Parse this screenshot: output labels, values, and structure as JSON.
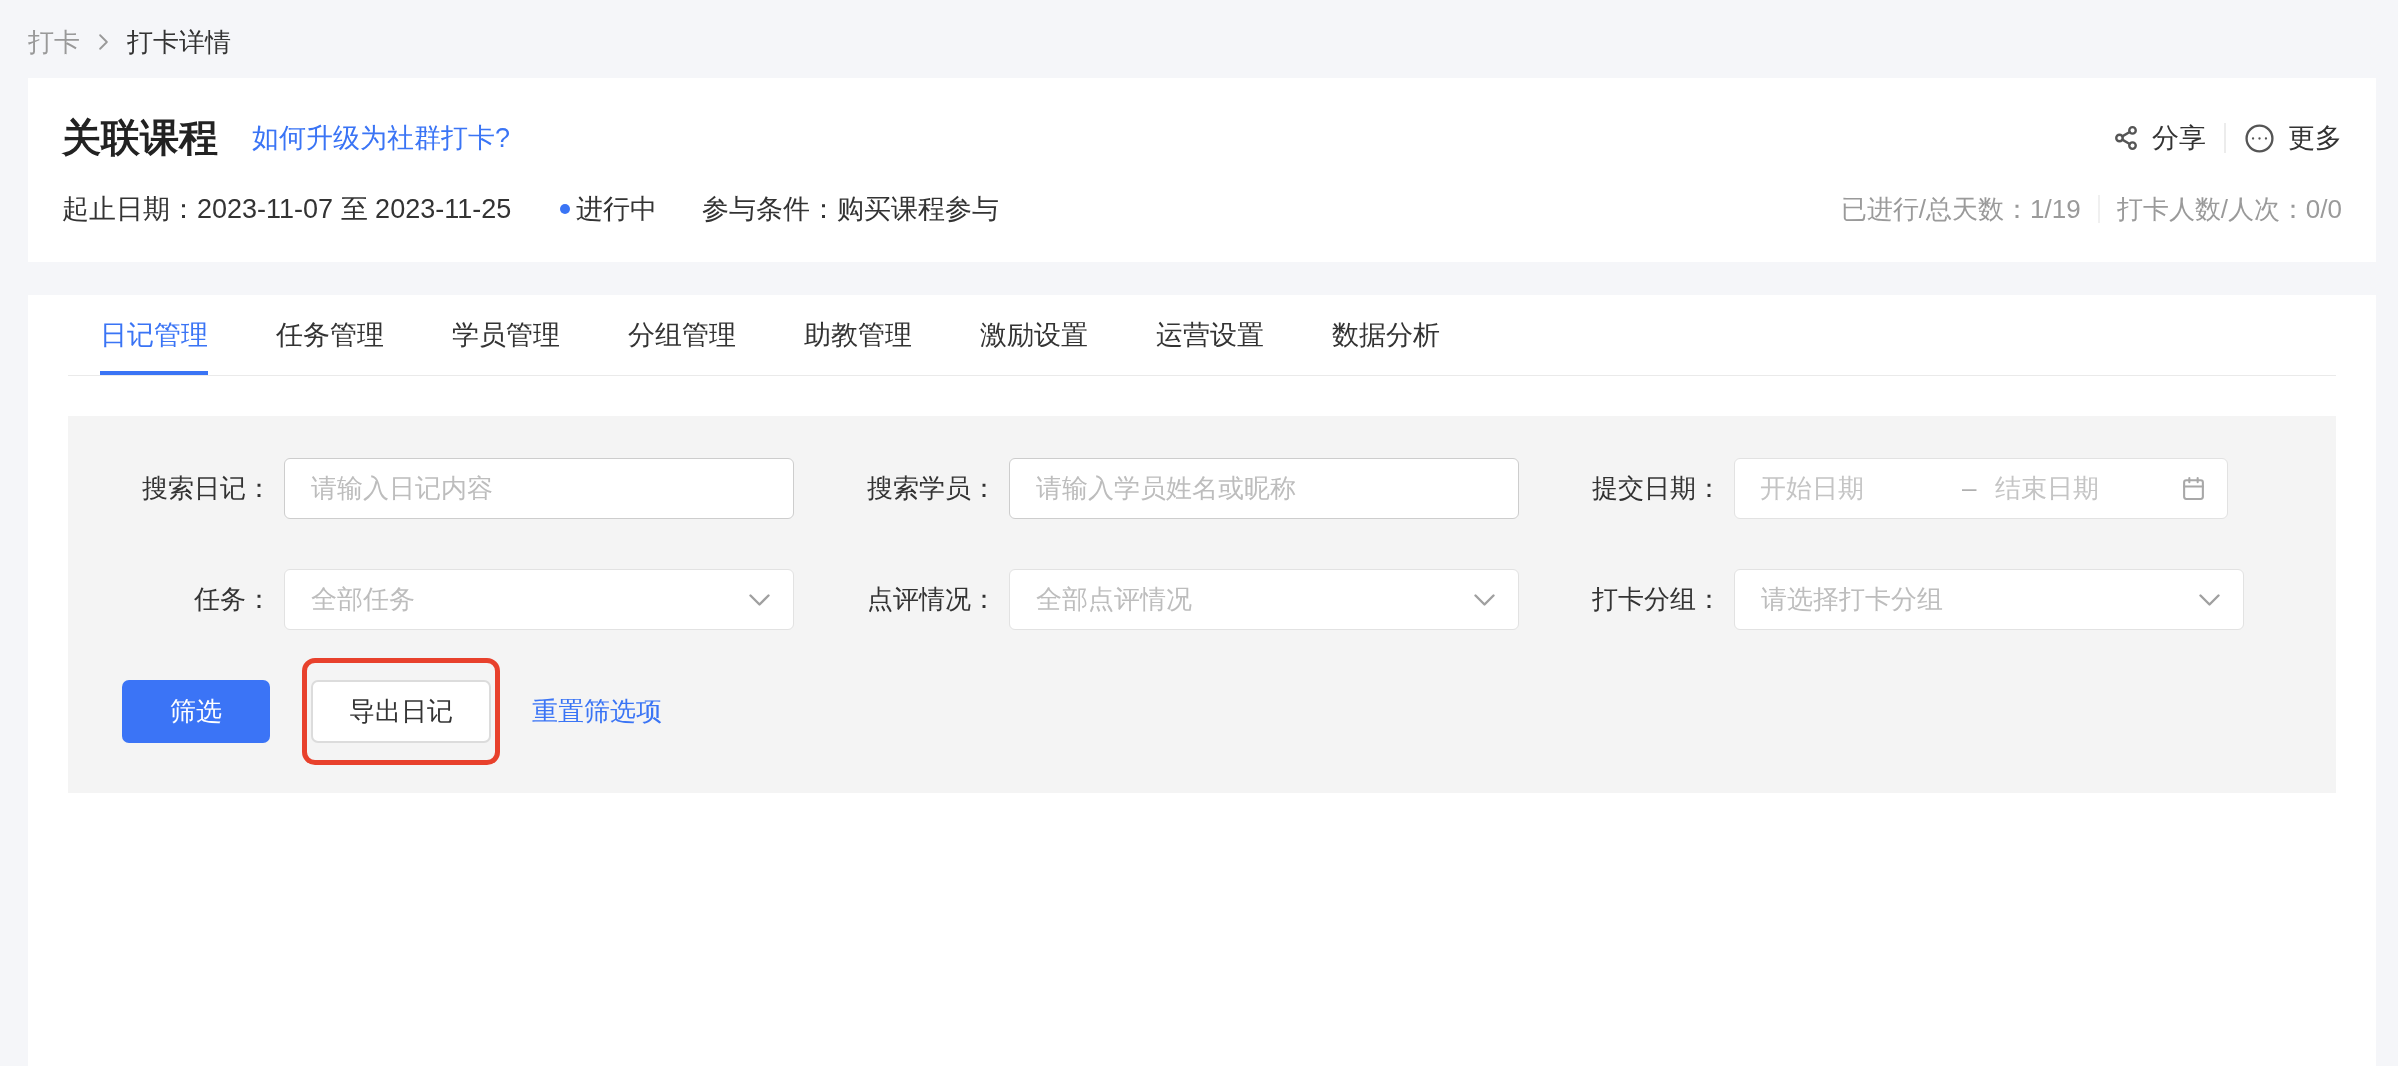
{
  "breadcrumb": [
    {
      "label": "打卡",
      "current": false
    },
    {
      "label": "打卡详情",
      "current": true
    }
  ],
  "header": {
    "title": "关联课程",
    "help_link": "如何升级为社群打卡?",
    "date_range": "起止日期：2023-11-07 至 2023-11-25",
    "status": {
      "label": "进行中",
      "color": "#3a74f5"
    },
    "condition": "参与条件：购买课程参与",
    "actions": [
      {
        "kind": "share",
        "label": "分享"
      },
      {
        "kind": "more",
        "label": "更多"
      }
    ],
    "stats": [
      "已进行/总天数：1/19",
      "打卡人数/人次：0/0"
    ]
  },
  "tabs": [
    {
      "label": "日记管理",
      "selected": true
    },
    {
      "label": "任务管理",
      "selected": false
    },
    {
      "label": "学员管理",
      "selected": false
    },
    {
      "label": "分组管理",
      "selected": false
    },
    {
      "label": "助教管理",
      "selected": false
    },
    {
      "label": "激励设置",
      "selected": false
    },
    {
      "label": "运营设置",
      "selected": false
    },
    {
      "label": "数据分析",
      "selected": false
    }
  ],
  "filters": [
    {
      "kind": "text",
      "label": "搜索日记：",
      "placeholder": "请输入日记内容"
    },
    {
      "kind": "text",
      "label": "搜索学员：",
      "placeholder": "请输入学员姓名或昵称"
    },
    {
      "kind": "date_range",
      "label": "提交日期：",
      "start_placeholder": "开始日期",
      "separator": "–",
      "end_placeholder": "结束日期"
    },
    {
      "kind": "select",
      "label": "任务：",
      "placeholder": "全部任务"
    },
    {
      "kind": "select",
      "label": "点评情况：",
      "placeholder": "全部点评情况"
    },
    {
      "kind": "select",
      "label": "打卡分组：",
      "placeholder": "请选择打卡分组"
    }
  ],
  "actions": [
    {
      "kind": "primary",
      "label": "筛选",
      "highlighted": false
    },
    {
      "kind": "outline",
      "label": "导出日记",
      "highlighted": true
    },
    {
      "kind": "link",
      "label": "重置筛选项",
      "highlighted": false
    }
  ]
}
